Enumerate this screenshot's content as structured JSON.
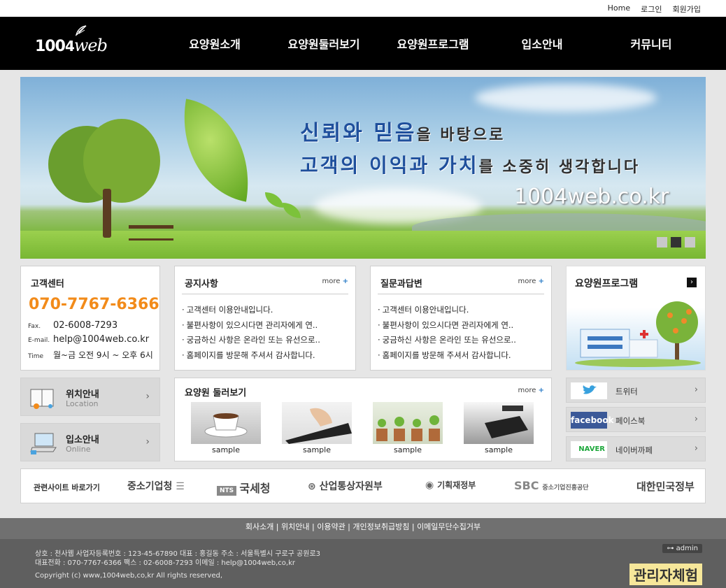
{
  "top_links": [
    "Home",
    "로그인",
    "회원가입"
  ],
  "logo": {
    "main": "100",
    "script": "web",
    "leaf": "4"
  },
  "nav": [
    "요양원소개",
    "요양원둘러보기",
    "요양원프로그램",
    "입소안내",
    "커뮤니티"
  ],
  "banner": {
    "line1_a": "신뢰와 믿음",
    "line1_b": "을 바탕으로",
    "line2_a": "고객의 이익과 가치",
    "line2_b": "를 소중히 생각합니다",
    "url": "1004web.co.kr",
    "active_slide": 2,
    "slide_count": 3
  },
  "customer_center": {
    "title": "고객센터",
    "phone": "070-7767-6366",
    "fax_label": "Fax.",
    "fax": "02-6008-7293",
    "email_label": "E-mail.",
    "email": "help@1004web.co.kr",
    "time_label": "Time",
    "time": "월~금 오전 9시 ~ 오후 6시"
  },
  "notice": {
    "title": "공지사항",
    "more": "more",
    "items": [
      "고객센터 이용안내입니다.",
      "불편사항이 있으시다면 관리자에게 연..",
      "궁금하신 사항은 온라인 또는 유선으로..",
      "홈페이지를 방문해 주셔서 감사합니다."
    ]
  },
  "qna": {
    "title": "질문과답변",
    "more": "more",
    "items": [
      "고객센터 이용안내입니다.",
      "불편사항이 있으시다면 관리자에게 연..",
      "궁금하신 사항은 온라인 또는 유선으로..",
      "홈페이지를 방문해 주셔서 감사합니다."
    ]
  },
  "program": {
    "title": "요양원프로그램",
    "arrow": "›"
  },
  "location": {
    "title": "위치안내",
    "sub": "Location",
    "arrow": "›"
  },
  "admission": {
    "title": "입소안내",
    "sub": "Online",
    "arrow": "›"
  },
  "gallery": {
    "title": "요양원 둘러보기",
    "more": "more",
    "captions": [
      "sample",
      "sample",
      "sample",
      "sample"
    ]
  },
  "social": [
    {
      "label": "트위터",
      "icon": "twitter-icon",
      "arrow": "›"
    },
    {
      "label": "페이스북",
      "icon": "facebook-icon",
      "badge": "facebook",
      "arrow": "›"
    },
    {
      "label": "네이버까페",
      "icon": "naver-icon",
      "badge": "NAVER",
      "arrow": "›"
    }
  ],
  "related": {
    "label": "관련사이트 바로가기",
    "sites": [
      "중소기업청",
      "NTS",
      "국세청",
      "산업통상자원부",
      "기획재정부",
      "SBC",
      "중소기업진흥공단",
      "대한민국정부"
    ]
  },
  "footer_nav": [
    "회사소개",
    "위치안내",
    "이용약관",
    "개인정보취급방침",
    "이메일무단수집거부"
  ],
  "footer": {
    "line1": "상호 : 천사웹   사업자등록번호 : 123-45-67890  대표 : 홍길동   주소 : 서울특별시 구로구 공원로3",
    "line2": "대표전화 : 070-7767-6366  팩스 : 02-6008-7293  이메일 : help@1004web,co,kr",
    "copyright": "Copyright (c) www,1004web,co,kr All rights reserved,",
    "admin_label": "admin",
    "try_label": "관리자체험"
  },
  "colors": {
    "accent_orange": "#f28b1a",
    "slogan_blue": "#1f4f9c",
    "header_bg": "#000000",
    "more_plus": "#2a7cc7"
  }
}
